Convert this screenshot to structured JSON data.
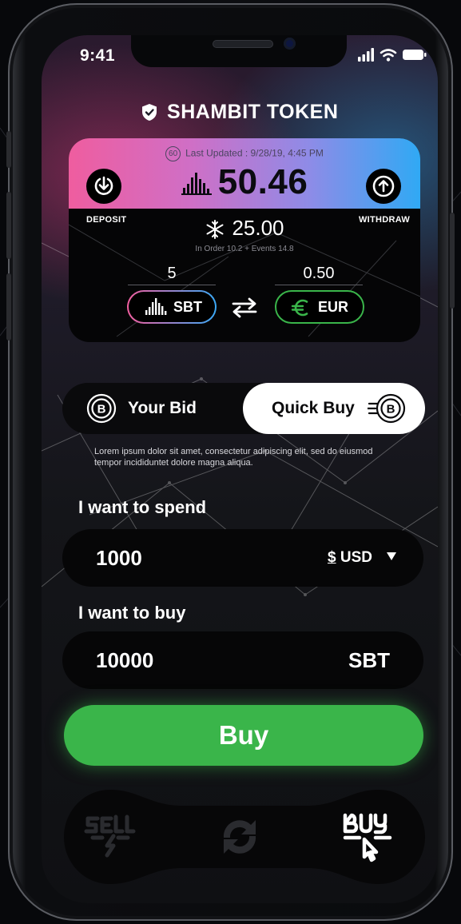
{
  "status_bar": {
    "time": "9:41"
  },
  "header": {
    "title": "SHAMBIT TOKEN",
    "icon": "shield-icon"
  },
  "card": {
    "updated_badge": "60",
    "last_updated": "Last Updated : 9/28/19, 4:45 PM",
    "balance": "50.46",
    "deposit_label": "DEPOSIT",
    "withdraw_label": "WITHDRAW",
    "frozen_value": "25.00",
    "frozen_sub": "In Order 10.2 + Events 14.8",
    "from_amount": "5",
    "to_amount": "0.50",
    "from_currency": "SBT",
    "to_currency": "EUR",
    "colors": {
      "gradient_start": "#ef5d9f",
      "gradient_end": "#30a9f4",
      "eur_green": "#3ab54a"
    }
  },
  "segment": {
    "your_bid": "Your Bid",
    "quick_buy": "Quick Buy",
    "selected": "Quick Buy"
  },
  "description": "Lorem ipsum dolor sit amet, consectetur adipiscing elit, sed do eiusmod tempor incididuntet dolore magna aliqua.",
  "spend": {
    "label": "I want to spend",
    "value": "1000",
    "currency": "USD",
    "currency_symbol": "$"
  },
  "receive": {
    "label": "I want to buy",
    "value": "10000",
    "currency": "SBT"
  },
  "buy_button": {
    "label": "Buy",
    "color": "#3ab54a"
  },
  "bottom_nav": {
    "items": [
      "sell-icon",
      "refresh-icon",
      "buy-icon"
    ],
    "active": "buy-icon"
  }
}
